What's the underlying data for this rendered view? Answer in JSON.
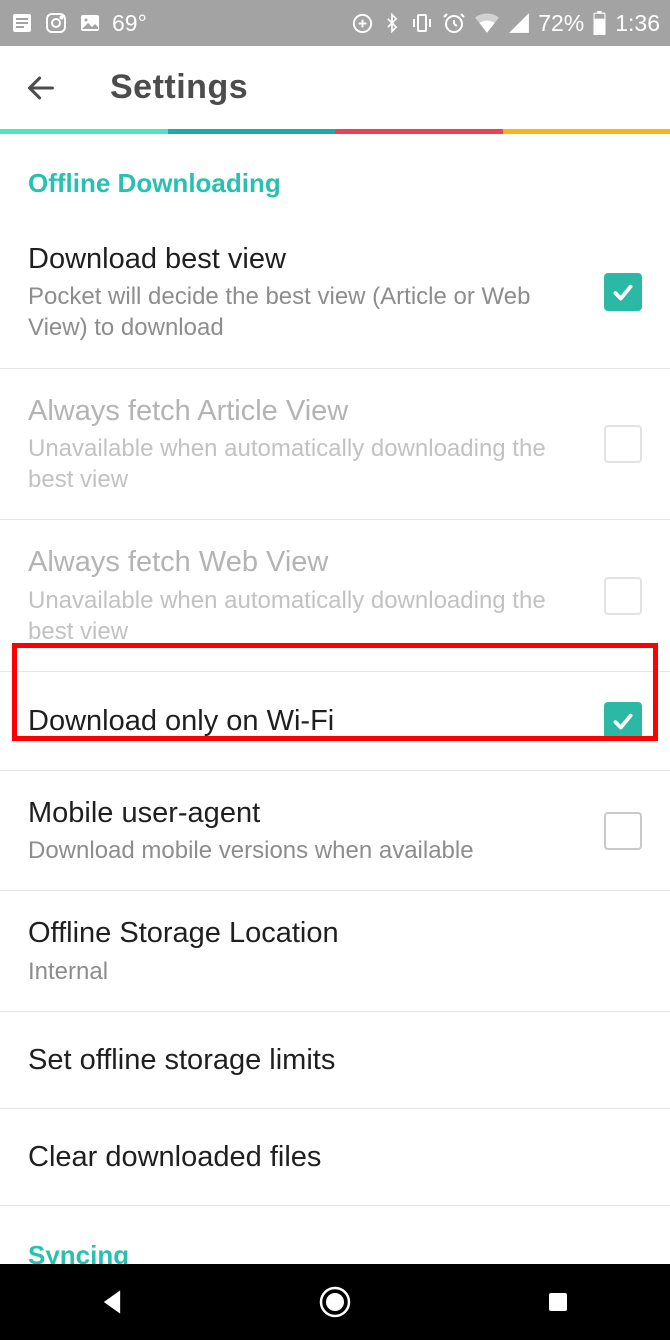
{
  "status": {
    "temp": "69°",
    "battery": "72%",
    "time": "1:36"
  },
  "header": {
    "title": "Settings"
  },
  "sections": {
    "offline_header": "Offline Downloading",
    "syncing_header": "Syncing"
  },
  "items": {
    "download_best_view": {
      "title": "Download best view",
      "subtitle": "Pocket will decide the best view (Article or Web View) to download"
    },
    "always_article": {
      "title": "Always fetch Article View",
      "subtitle": "Unavailable when automatically downloading the best view"
    },
    "always_web": {
      "title": "Always fetch Web View",
      "subtitle": "Unavailable when automatically downloading the best view"
    },
    "wifi_only": {
      "title": "Download only on Wi-Fi"
    },
    "mobile_ua": {
      "title": "Mobile user-agent",
      "subtitle": "Download mobile versions when available"
    },
    "storage_loc": {
      "title": "Offline Storage Location",
      "subtitle": "Internal"
    },
    "storage_limits": {
      "title": "Set offline storage limits"
    },
    "clear_files": {
      "title": "Clear downloaded files"
    }
  }
}
